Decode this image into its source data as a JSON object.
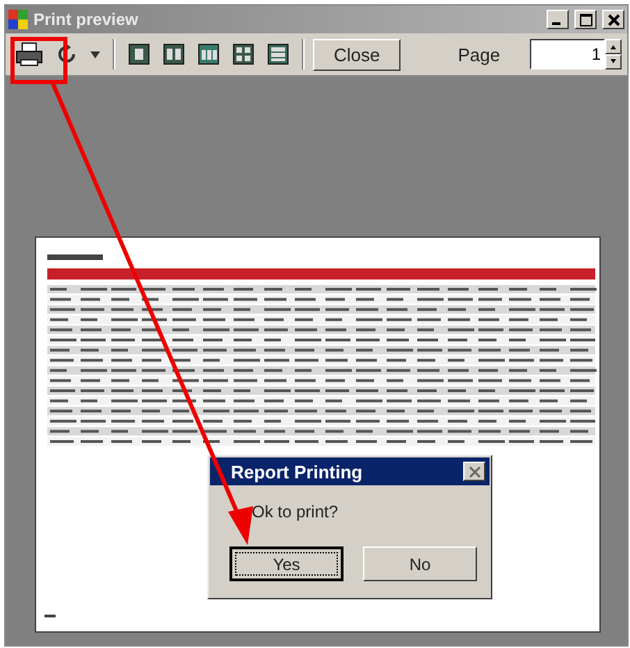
{
  "window": {
    "title": "Print preview"
  },
  "toolbar": {
    "close_button": "Close",
    "page_label": "Page",
    "page_field": {
      "value": "1"
    }
  },
  "dialog": {
    "title": "Report Printing",
    "message": "Ok to print?",
    "buttons": [
      {
        "label": "Yes",
        "selected": true
      },
      {
        "label": "No",
        "selected": false
      }
    ]
  }
}
